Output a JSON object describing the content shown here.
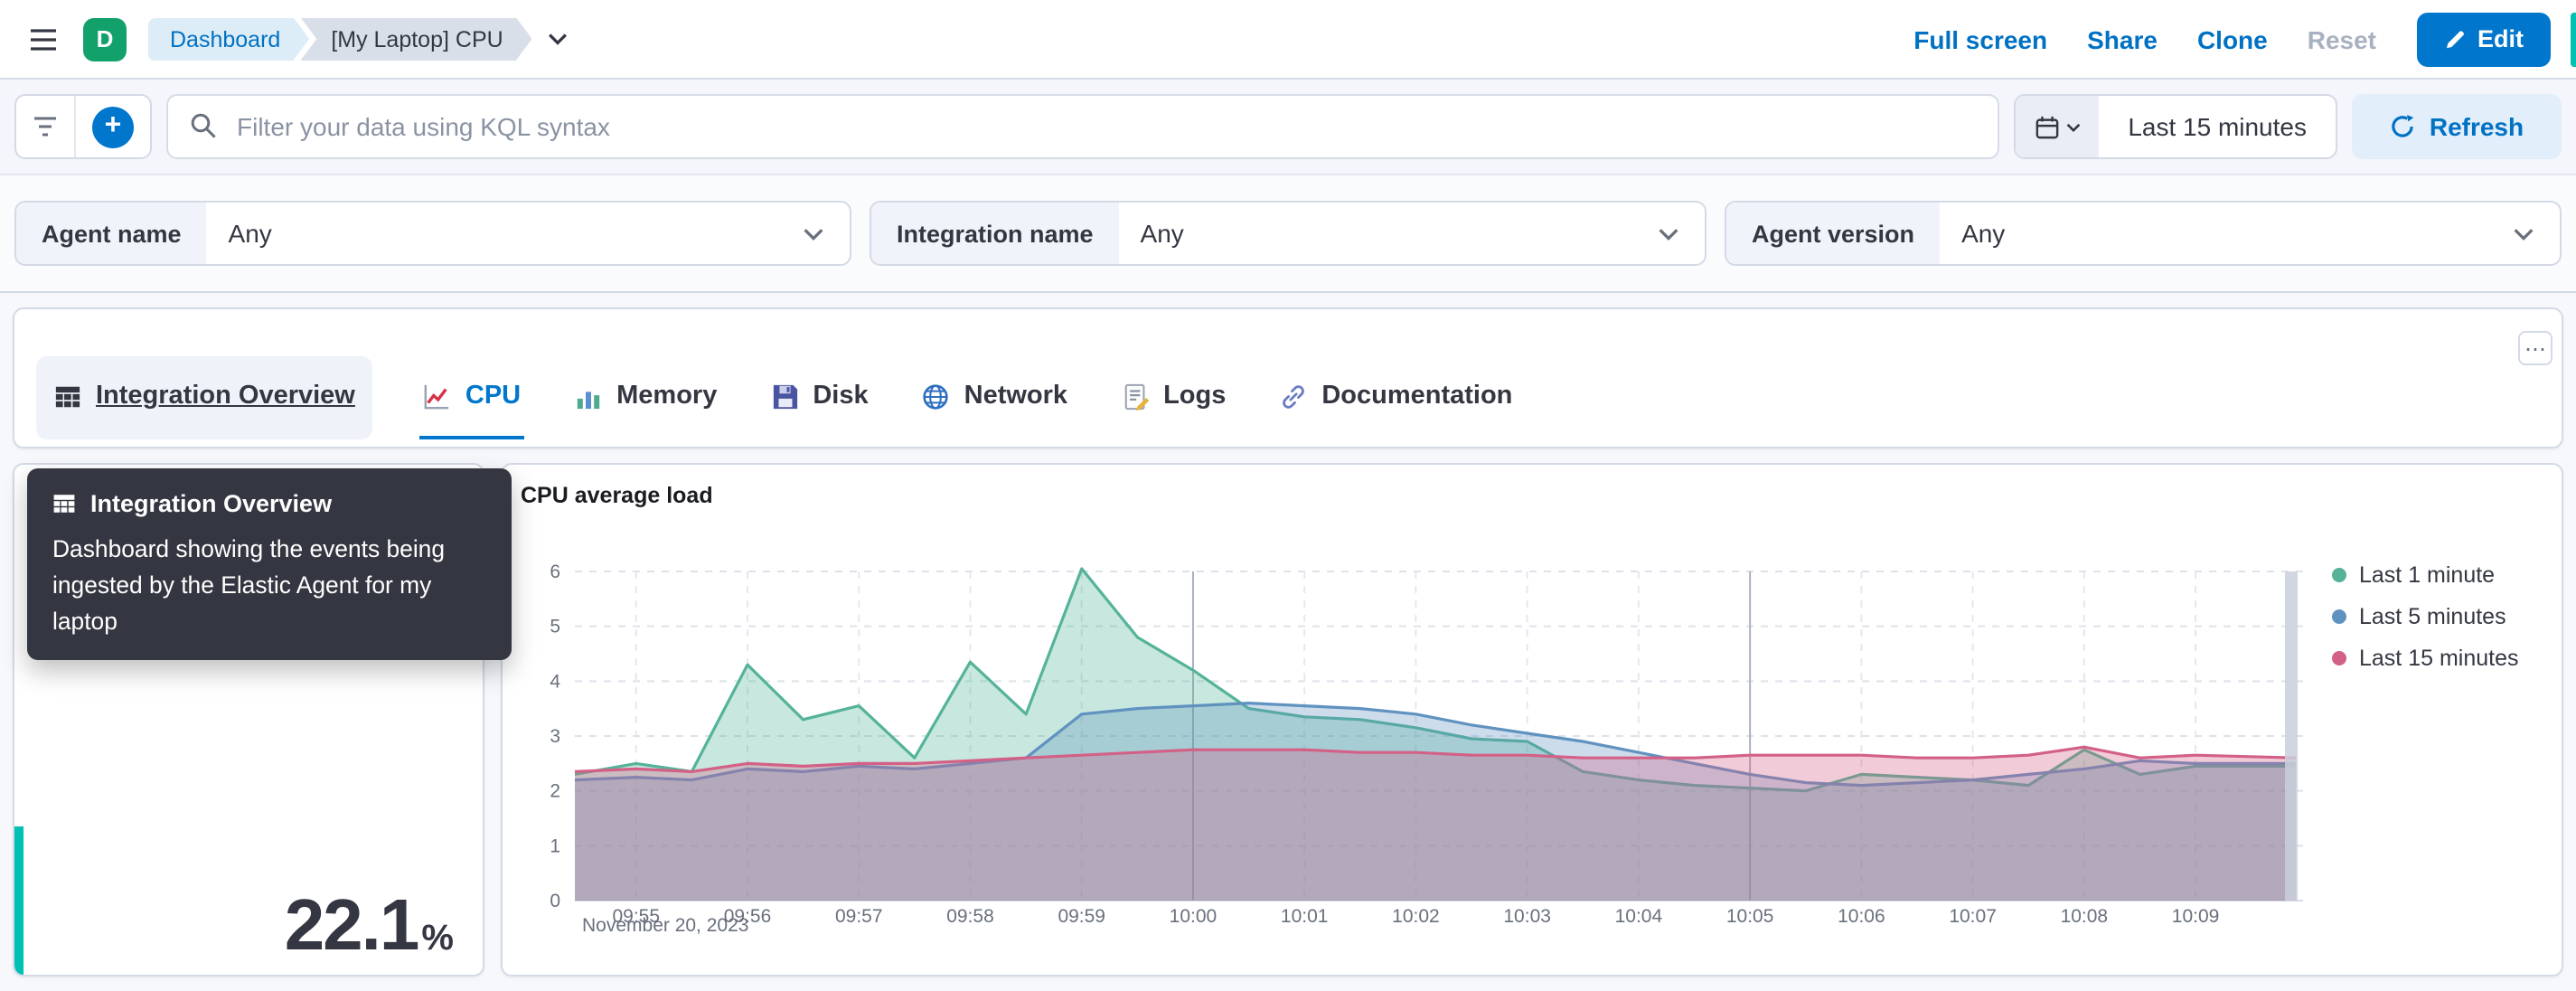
{
  "colors": {
    "primary": "#0077CC",
    "teal_accent": "#00BFB3",
    "space_avatar": "#12A16B"
  },
  "icons": {
    "panel_options": "⋯",
    "plus": "+"
  },
  "header": {
    "space_initial": "D",
    "breadcrumbs": [
      {
        "label": "Dashboard"
      },
      {
        "label": "[My Laptop] CPU"
      }
    ],
    "actions": {
      "full_screen": "Full screen",
      "share": "Share",
      "clone": "Clone",
      "reset": "Reset",
      "edit": "Edit"
    }
  },
  "query_bar": {
    "placeholder": "Filter your data using KQL syntax",
    "time_range": "Last 15 minutes",
    "refresh": "Refresh"
  },
  "filters": [
    {
      "label": "Agent name",
      "value": "Any"
    },
    {
      "label": "Integration name",
      "value": "Any"
    },
    {
      "label": "Agent version",
      "value": "Any"
    }
  ],
  "nav": {
    "tabs": [
      {
        "label": "Integration Overview"
      },
      {
        "label": "CPU"
      },
      {
        "label": "Memory"
      },
      {
        "label": "Disk"
      },
      {
        "label": "Network"
      },
      {
        "label": "Logs"
      },
      {
        "label": "Documentation"
      }
    ]
  },
  "tooltip": {
    "title": "Integration Overview",
    "body": "Dashboard showing the events being ingested by the Elastic Agent for my laptop"
  },
  "metric": {
    "value": "22.1",
    "unit": "%"
  },
  "chart_data": {
    "type": "area",
    "title": "CPU average load",
    "x_date_label": "November 20, 2023",
    "x_ticks": [
      "09:55",
      "09:56",
      "09:57",
      "09:58",
      "09:59",
      "10:00",
      "10:01",
      "10:02",
      "10:03",
      "10:04",
      "10:05",
      "10:06",
      "10:07",
      "10:08",
      "10:09"
    ],
    "x_minutes": [
      -0.55,
      0,
      0.5,
      1,
      1.5,
      2,
      2.5,
      3,
      3.5,
      4,
      4.5,
      5,
      5.5,
      6,
      6.5,
      7,
      7.5,
      8,
      8.5,
      9,
      9.5,
      10,
      10.5,
      11,
      11.5,
      12,
      12.5,
      13,
      13.5,
      14,
      14.9
    ],
    "ylim": [
      0,
      6
    ],
    "y_ticks": [
      0,
      1,
      2,
      3,
      4,
      5,
      6
    ],
    "legend_position": "right",
    "grid": true,
    "series": [
      {
        "name": "Last 1 minute",
        "color": "#54B399",
        "values": [
          2.3,
          2.5,
          2.35,
          4.3,
          3.3,
          3.55,
          2.6,
          4.35,
          3.4,
          6.05,
          4.8,
          4.2,
          3.5,
          3.35,
          3.3,
          3.15,
          2.95,
          2.9,
          2.35,
          2.2,
          2.1,
          2.05,
          2.0,
          2.3,
          2.25,
          2.2,
          2.1,
          2.75,
          2.3,
          2.45,
          2.45
        ]
      },
      {
        "name": "Last 5 minutes",
        "color": "#6092C0",
        "values": [
          2.2,
          2.25,
          2.2,
          2.4,
          2.35,
          2.45,
          2.4,
          2.5,
          2.6,
          3.4,
          3.5,
          3.55,
          3.6,
          3.55,
          3.5,
          3.4,
          3.2,
          3.05,
          2.9,
          2.7,
          2.5,
          2.3,
          2.15,
          2.1,
          2.15,
          2.2,
          2.3,
          2.4,
          2.55,
          2.5,
          2.5
        ]
      },
      {
        "name": "Last 15 minutes",
        "color": "#D36086",
        "values": [
          2.35,
          2.4,
          2.35,
          2.5,
          2.45,
          2.5,
          2.5,
          2.55,
          2.6,
          2.65,
          2.7,
          2.75,
          2.75,
          2.75,
          2.7,
          2.7,
          2.65,
          2.65,
          2.6,
          2.6,
          2.6,
          2.65,
          2.65,
          2.65,
          2.6,
          2.6,
          2.65,
          2.8,
          2.6,
          2.65,
          2.6
        ]
      }
    ]
  }
}
